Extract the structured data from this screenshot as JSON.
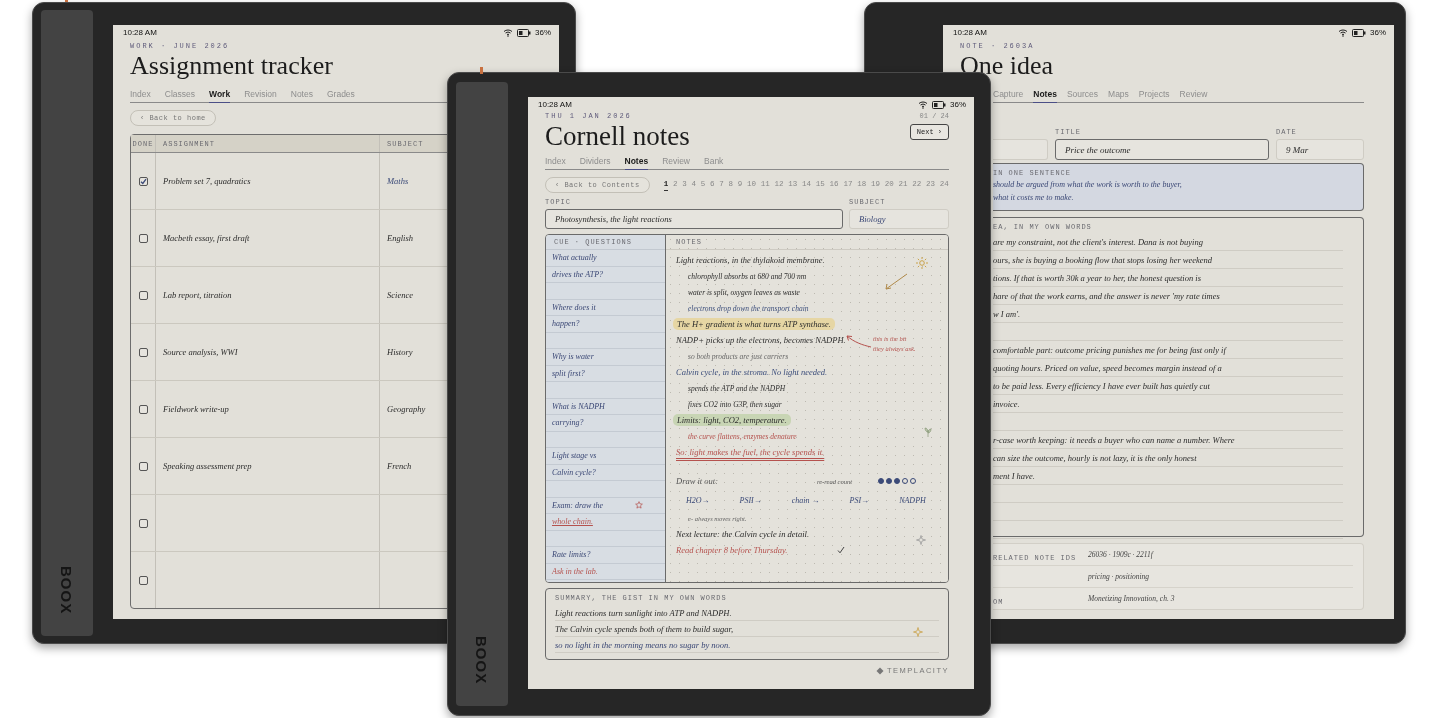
{
  "tracker_device": {
    "logo": "BOOX",
    "status": {
      "time": "10:28 AM",
      "battery": "36%"
    },
    "eyebrow": "WORK · JUNE 2026",
    "title": "Assignment tracker",
    "tabs": [
      {
        "label": "Index",
        "selected": false
      },
      {
        "label": "Classes",
        "selected": false
      },
      {
        "label": "Work",
        "selected": true
      },
      {
        "label": "Revision",
        "selected": false
      },
      {
        "label": "Notes",
        "selected": false
      },
      {
        "label": "Grades",
        "selected": false
      }
    ],
    "back_button": "‹ Back to home",
    "table": {
      "columns": [
        "DONE",
        "ASSIGNMENT",
        "SUBJECT"
      ],
      "rows": [
        {
          "checked": true,
          "assignment": "Problem set 7, quadratics",
          "subject": "Maths"
        },
        {
          "checked": false,
          "assignment": "Macbeth essay, first draft",
          "subject": "English"
        },
        {
          "checked": false,
          "assignment": "Lab report, titration",
          "subject": "Science"
        },
        {
          "checked": false,
          "assignment": "Source analysis, WWI",
          "subject": "History"
        },
        {
          "checked": false,
          "assignment": "Fieldwork write-up",
          "subject": "Geography"
        },
        {
          "checked": false,
          "assignment": "Speaking assessment prep",
          "subject": "French"
        },
        {
          "checked": false
        },
        {
          "checked": false
        }
      ]
    }
  },
  "cornell_device": {
    "logo": "BOOX",
    "status": {
      "time": "10:28 AM",
      "battery": "36%"
    },
    "date": "THU 1 JAN 2026",
    "page_count": "01 / 24",
    "title": "Cornell notes",
    "next_button": "Next ›",
    "tabs": [
      {
        "label": "Index",
        "selected": false
      },
      {
        "label": "Dividers",
        "selected": false
      },
      {
        "label": "Notes",
        "selected": true
      },
      {
        "label": "Review",
        "selected": false
      },
      {
        "label": "Bank",
        "selected": false
      }
    ],
    "back_button": "‹ Back to Contents",
    "pages": [
      {
        "label": "1",
        "selected": true
      },
      {
        "label": "2",
        "selected": false
      },
      {
        "label": "3",
        "selected": false
      },
      {
        "label": "4",
        "selected": false
      },
      {
        "label": "5",
        "selected": false
      },
      {
        "label": "6",
        "selected": false
      },
      {
        "label": "7",
        "selected": false
      },
      {
        "label": "8",
        "selected": false
      },
      {
        "label": "9",
        "selected": false
      },
      {
        "label": "10",
        "selected": false
      },
      {
        "label": "11",
        "selected": false
      },
      {
        "label": "12",
        "selected": false
      },
      {
        "label": "13",
        "selected": false
      },
      {
        "label": "14",
        "selected": false
      },
      {
        "label": "15",
        "selected": false
      },
      {
        "label": "16",
        "selected": false
      },
      {
        "label": "17",
        "selected": false
      },
      {
        "label": "18",
        "selected": false
      },
      {
        "label": "19",
        "selected": false
      },
      {
        "label": "20",
        "selected": false
      },
      {
        "label": "21",
        "selected": false
      },
      {
        "label": "22",
        "selected": false
      },
      {
        "label": "23",
        "selected": false
      },
      {
        "label": "24",
        "selected": false
      }
    ],
    "topic": {
      "label": "TOPIC",
      "value": "Photosynthesis, the light reactions"
    },
    "subject": {
      "label": "SUBJECT",
      "value": "Biology"
    },
    "cue": {
      "heading": "CUE · QUESTIONS",
      "groups": [
        {
          "starred": false,
          "lines": [
            {
              "kind": "question",
              "text": "What actually"
            },
            {
              "kind": "question",
              "text": "drives the ATP?"
            }
          ]
        },
        {
          "starred": false,
          "lines": [
            {
              "kind": "question",
              "text": "Where does it"
            },
            {
              "kind": "question",
              "text": "happen?"
            }
          ]
        },
        {
          "starred": false,
          "lines": [
            {
              "kind": "question",
              "text": "Why is water"
            },
            {
              "kind": "question",
              "text": "split first?"
            }
          ]
        },
        {
          "starred": false,
          "lines": [
            {
              "kind": "question",
              "text": "What is NADPH"
            },
            {
              "kind": "question",
              "text": "carrying?"
            }
          ]
        },
        {
          "starred": false,
          "lines": [
            {
              "kind": "question",
              "text": "Light stage vs"
            },
            {
              "kind": "question",
              "text": "Calvin cycle?"
            }
          ]
        },
        {
          "starred": true,
          "lines": [
            {
              "kind": "question",
              "text": "Exam: draw the"
            },
            {
              "kind": "task",
              "text": "whole chain."
            }
          ]
        },
        {
          "starred": false,
          "lines": [
            {
              "kind": "question",
              "text": "Rate limits?"
            },
            {
              "kind": "answer",
              "text": "Ask in the lab."
            }
          ]
        }
      ]
    },
    "notes": {
      "heading": "NOTES",
      "lines": [
        {
          "kind": "line",
          "text": "Light reactions, in the thylakoid membrane."
        },
        {
          "kind": "sub",
          "text": "chlorophyll absorbs at 680 and 700 nm"
        },
        {
          "kind": "sub",
          "text": "water is split, oxygen leaves as waste"
        },
        {
          "kind": "bluesub",
          "text": "electrons drop down the transport chain"
        },
        {
          "kind": "highlight",
          "text": "The H+ gradient is what turns ATP synthase.",
          "color": "#e6d6a4"
        },
        {
          "kind": "line",
          "text": "NADP+ picks up the electrons, becomes NADPH."
        },
        {
          "kind": "greysub",
          "text": "so both products are just carriers"
        },
        {
          "kind": "blueline",
          "text": "Calvin cycle, in the stroma. No light needed."
        },
        {
          "kind": "sub",
          "text": "spends the ATP and the NADPH"
        },
        {
          "kind": "sub",
          "text": "fixes CO2 into G3P, then sugar"
        },
        {
          "kind": "highlight",
          "text": "Limits: light, CO2, temperature.",
          "color": "#c8d5b4"
        },
        {
          "kind": "redsub",
          "text": "the curve flattens, enzymes denature"
        },
        {
          "kind": "underlined",
          "text": "So: light makes the fuel, the cycle spends it."
        }
      ],
      "annotation": [
        "this is the bit",
        "they always ask."
      ],
      "draw_label": "Draw it out:",
      "reread": {
        "label": "re-read count",
        "dots": [
          {
            "filled": true
          },
          {
            "filled": true
          },
          {
            "filled": true
          },
          {
            "filled": false
          },
          {
            "filled": false
          }
        ]
      },
      "flow": [
        "H2O→",
        "PSII→",
        "chain →",
        "PSI→",
        "NADPH"
      ],
      "flow_note": "e- always moves right.",
      "next_lecture": "Next lecture: the Calvin cycle in detail.",
      "todo": {
        "text": "Read chapter 8 before Thursday.",
        "done": true
      }
    },
    "summary": {
      "heading": "SUMMARY, THE GIST IN MY OWN WORDS",
      "lines": [
        "Light reactions turn sunlight into ATP and NADPH.",
        "The Calvin cycle spends both of them to build sugar,",
        "so no light in the morning means no sugar by noon."
      ]
    },
    "brand": "TEMPLACITY"
  },
  "note_device": {
    "status": {
      "time": "10:28 AM",
      "battery": "36%"
    },
    "eyebrow": "NOTE · 2603A",
    "title": "One idea",
    "tabs": [
      {
        "label": "Capture",
        "selected": false
      },
      {
        "label": "Notes",
        "selected": true
      },
      {
        "label": "Sources",
        "selected": false
      },
      {
        "label": "Maps",
        "selected": false
      },
      {
        "label": "Projects",
        "selected": false
      },
      {
        "label": "Review",
        "selected": false
      }
    ],
    "fields": [
      {
        "label": "TITLE",
        "value": "Price the outcome"
      },
      {
        "label": "DATE",
        "value": "9 Mar"
      }
    ],
    "sentence": {
      "heading": "IN ONE SENTENCE",
      "lines": [
        "should be argued from what the work is worth to the buyer,",
        "what it costs me to make."
      ]
    },
    "idea": {
      "heading": "EA, IN MY OWN WORDS",
      "paragraphs": [
        [
          "are my constraint, not the client's interest. Dana is not buying",
          "ours, she is buying a booking flow that stops losing her weekend",
          "tions. If that is worth 30k a year to her, the honest question is",
          "hare of that the work earns, and the answer is never 'my rate times",
          "w I am'."
        ],
        [
          "comfortable part: outcome pricing punishes me for being fast only if",
          "quoting hours. Priced on value, speed becomes margin instead of a",
          "to be paid less. Every efficiency I have ever built has quietly cut",
          "invoice."
        ],
        [
          "r-case worth keeping: it needs a buyer who can name a number. Where",
          "can size the outcome, hourly is not lazy, it is the only honest",
          "ment I have."
        ]
      ]
    },
    "meta": [
      {
        "label": "RELATED NOTE IDS",
        "value": "26036 · 1909c · 2211f"
      },
      {
        "value": "pricing · positioning"
      },
      {
        "label": "OM",
        "value": "Monetizing Innovation, ch. 3"
      }
    ]
  }
}
